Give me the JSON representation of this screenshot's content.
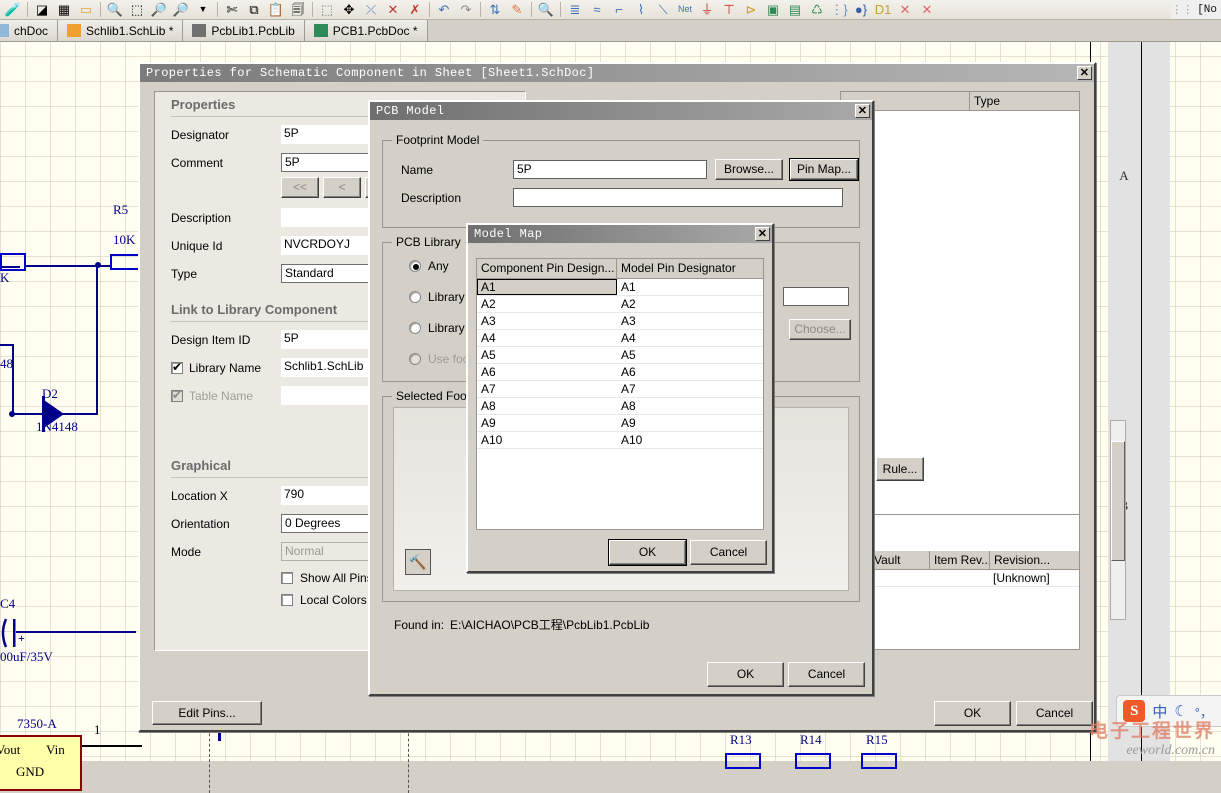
{
  "toolbar": {
    "icons": [
      "dropper-icon",
      "layers-icon",
      "board-icon",
      "folder-icon",
      "zoom-in-icon",
      "zoom-area-icon",
      "zoom-select-icon",
      "zoom-filter-icon",
      "chevron-down-icon",
      "cut-icon",
      "copy-icon",
      "paste-icon",
      "copy-stack-icon",
      "select-rect-icon",
      "move-icon",
      "smart-paste-icon",
      "clear-icon",
      "cross-undo-icon",
      "undo-icon",
      "redo-icon",
      "updown-icon",
      "wand-icon",
      "inspect-icon",
      "align-icon",
      "wire-icon",
      "bus-icon",
      "bus-entry-icon",
      "line-icon",
      "netlabel-icon",
      "gnd-icon",
      "vcc-icon",
      "port-icon",
      "sheet-symbol-icon",
      "sheet-entry-icon",
      "device-sheet-icon",
      "harness-icon",
      "harness-entry-icon",
      "no-erc-icon",
      "no-erc-2-icon"
    ],
    "status_right": "[No"
  },
  "tabs": [
    {
      "label": "chDoc",
      "icon": "schdoc-icon",
      "active": false
    },
    {
      "label": "Schlib1.SchLib *",
      "icon": "schlib-icon",
      "active": false
    },
    {
      "label": "PcbLib1.PcbLib",
      "icon": "pcblib-icon",
      "active": false
    },
    {
      "label": "PCB1.PcbDoc *",
      "icon": "pcbdoc-icon",
      "active": false
    }
  ],
  "schematic": {
    "zone_labels": [
      "A",
      "B"
    ],
    "parts": [
      {
        "ref": "R5",
        "value": "10K"
      },
      {
        "ref": "D2",
        "value": "1N4148"
      },
      {
        "ref": "C4",
        "value": "00uF/35V"
      },
      {
        "ref": "7350-A",
        "value": ""
      },
      {
        "ref": "R13",
        "value": ""
      },
      {
        "ref": "R14",
        "value": ""
      },
      {
        "ref": "R15",
        "value": ""
      }
    ],
    "fragments": [
      "K",
      "48",
      "8"
    ],
    "regulator": {
      "left_pin": "Vout",
      "right_pin": "Vin",
      "bottom_pin": "GND",
      "pin_number": "1"
    }
  },
  "properties_dialog": {
    "title": "Properties for Schematic Component in Sheet  [Sheet1.SchDoc]",
    "close_label": "✕",
    "properties_section": {
      "heading": "Properties",
      "fields": [
        {
          "label": "Designator",
          "value": "5P"
        },
        {
          "label": "Comment",
          "value": "5P"
        },
        {
          "label": "Description",
          "value": ""
        },
        {
          "label": "Unique Id",
          "value": "NVCRDOYJ"
        },
        {
          "label": "Type",
          "value": "Standard"
        }
      ],
      "nav_buttons": [
        "<<",
        "<",
        ">"
      ]
    },
    "link_section": {
      "heading": "Link to Library Component",
      "design_item_id_label": "Design Item ID",
      "design_item_id_value": "5P",
      "library_name_label": "Library Name",
      "library_name_value": "Schlib1.SchLib",
      "library_name_checked": true,
      "table_name_label": "Table Name",
      "table_name_value": "",
      "table_name_checked": true,
      "table_name_disabled": true
    },
    "graphical_section": {
      "heading": "Graphical",
      "location_x_label": "Location  X",
      "location_x_value": "790",
      "orientation_label": "Orientation",
      "orientation_value": "0 Degrees",
      "mode_label": "Mode",
      "mode_value": "Normal",
      "show_all_pins_label": "Show All Pins On",
      "local_colors_label": "Local Colors"
    },
    "edit_pins_button": "Edit Pins...",
    "rule_button": "Rule...",
    "models_columns": [
      "Type"
    ],
    "vault_columns": [
      "Vault",
      "Item Rev...",
      "Revision..."
    ],
    "vault_row_value": "[Unknown]",
    "ok_button": "OK",
    "cancel_button": "Cancel"
  },
  "pcb_model_dialog": {
    "title": "PCB Model",
    "close_label": "✕",
    "footprint_group": "Footprint Model",
    "name_label": "Name",
    "name_value": "5P",
    "description_label": "Description",
    "description_value": "",
    "browse_button": "Browse...",
    "pin_map_button": "Pin Map...",
    "pcb_library_group": "PCB Library",
    "radios": [
      {
        "label": "Any",
        "selected": true,
        "disabled": false
      },
      {
        "label": "Library n",
        "selected": false,
        "disabled": false
      },
      {
        "label": "Library p",
        "selected": false,
        "disabled": false
      },
      {
        "label": "Use foot",
        "selected": false,
        "disabled": true
      }
    ],
    "choose_button": "Choose...",
    "selected_footprint_group": "Selected Foo",
    "preview_tool_icon": "hammer-wrench-icon",
    "found_in_label": "Found in:",
    "found_in_path": "E:\\AICHAO\\PCB工程\\PcbLib1.PcbLib",
    "ok_button": "OK",
    "cancel_button": "Cancel"
  },
  "model_map_dialog": {
    "title": "Model Map",
    "close_label": "✕",
    "columns": [
      "Component Pin Design...",
      "Model Pin Designator"
    ],
    "rows": [
      {
        "component_pin": "A1",
        "model_pin": "A1",
        "selected": true
      },
      {
        "component_pin": "A2",
        "model_pin": "A2",
        "selected": false
      },
      {
        "component_pin": "A3",
        "model_pin": "A3",
        "selected": false
      },
      {
        "component_pin": "A4",
        "model_pin": "A4",
        "selected": false
      },
      {
        "component_pin": "A5",
        "model_pin": "A5",
        "selected": false
      },
      {
        "component_pin": "A6",
        "model_pin": "A6",
        "selected": false
      },
      {
        "component_pin": "A7",
        "model_pin": "A7",
        "selected": false
      },
      {
        "component_pin": "A8",
        "model_pin": "A8",
        "selected": false
      },
      {
        "component_pin": "A9",
        "model_pin": "A9",
        "selected": false
      },
      {
        "component_pin": "A10",
        "model_pin": "A10",
        "selected": false
      }
    ],
    "ok_button": "OK",
    "cancel_button": "Cancel"
  },
  "ime": {
    "logo": "S",
    "mode": "中",
    "moon": "☾",
    "punct": "°，"
  },
  "watermark": {
    "cn": "电子工程世界",
    "en": "eeworld.com.cn"
  },
  "colors": {
    "dialog_face": "#d4d0c8",
    "panel_face": "#ece9e3",
    "canvas": "#fffef0",
    "wire": "#00008b",
    "accent_red": "#8b0000",
    "part_fill": "#ffffaa"
  }
}
